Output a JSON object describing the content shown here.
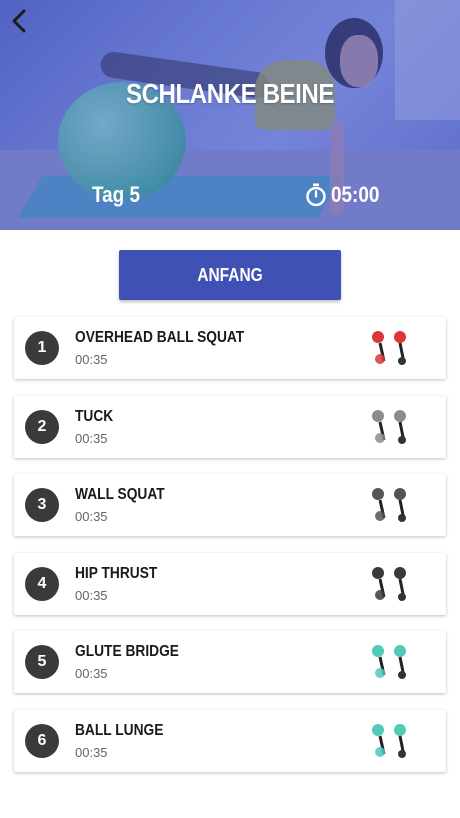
{
  "header": {
    "back_icon": "chevron-left-icon",
    "title": "SCHLANKE BEINE",
    "day": "Tag 5",
    "timer_icon": "stopwatch-icon",
    "duration": "05:00"
  },
  "start_button": {
    "label": "ANFANG",
    "color": "#3f51b5"
  },
  "exercises": [
    {
      "number": "1",
      "name": "OVERHEAD BALL SQUAT",
      "time": "00:35",
      "thumb_color": "#d9373a"
    },
    {
      "number": "2",
      "name": "TUCK",
      "time": "00:35",
      "thumb_color": "#8c8c8c"
    },
    {
      "number": "3",
      "name": "WALL SQUAT",
      "time": "00:35",
      "thumb_color": "#555555"
    },
    {
      "number": "4",
      "name": "HIP THRUST",
      "time": "00:35",
      "thumb_color": "#3a3a3a"
    },
    {
      "number": "5",
      "name": "GLUTE BRIDGE",
      "time": "00:35",
      "thumb_color": "#4fc9b8"
    },
    {
      "number": "6",
      "name": "BALL LUNGE",
      "time": "00:35",
      "thumb_color": "#4fc9b8"
    }
  ]
}
